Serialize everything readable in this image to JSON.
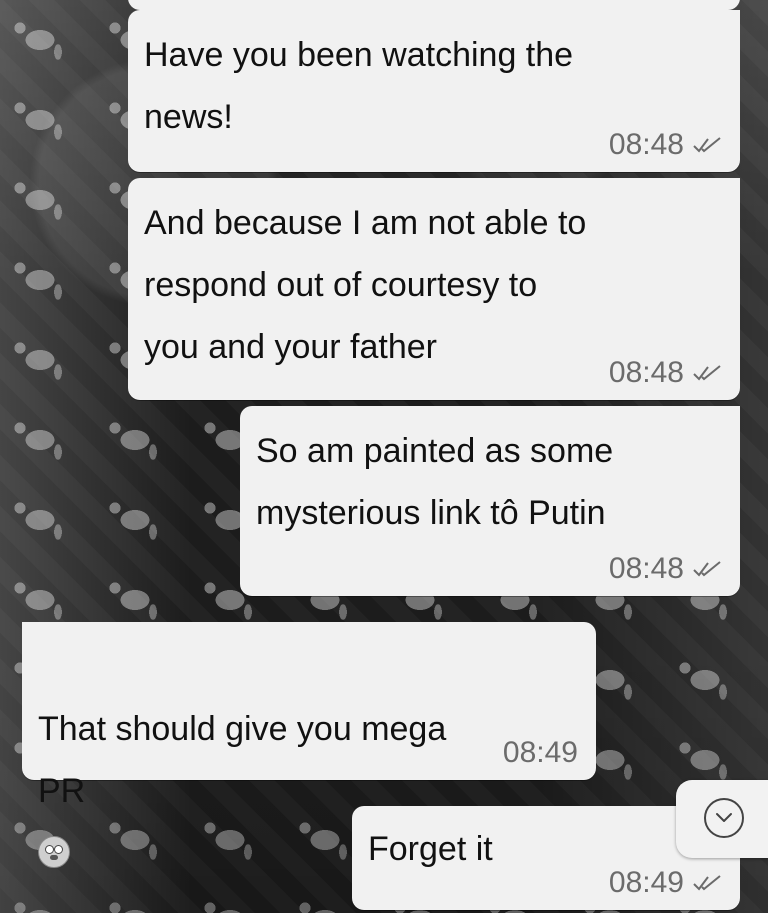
{
  "chat": {
    "messages": [
      {
        "direction": "out",
        "text": "Have you been watching the\nnews!",
        "time": "08:48",
        "status": "read"
      },
      {
        "direction": "out",
        "text": "And because I am not able to\nrespond out of courtesy to\nyou and your father",
        "time": "08:48",
        "status": "read"
      },
      {
        "direction": "out",
        "text": "So am painted as some\nmysterious link tô Putin",
        "time": "08:48",
        "status": "read"
      },
      {
        "direction": "in",
        "text": "That should give you mega\nPR",
        "emoji": "flushed-face",
        "time": "08:49"
      },
      {
        "direction": "out",
        "text": "Forget it",
        "time": "08:49",
        "status": "read"
      }
    ]
  },
  "controls": {
    "scroll_to_bottom_icon": "chevron-down-circle-icon"
  },
  "colors": {
    "bubble_bg": "#f1f1f1",
    "meta_text": "#6b6b6b",
    "wallpaper": "#1e1e1e"
  }
}
